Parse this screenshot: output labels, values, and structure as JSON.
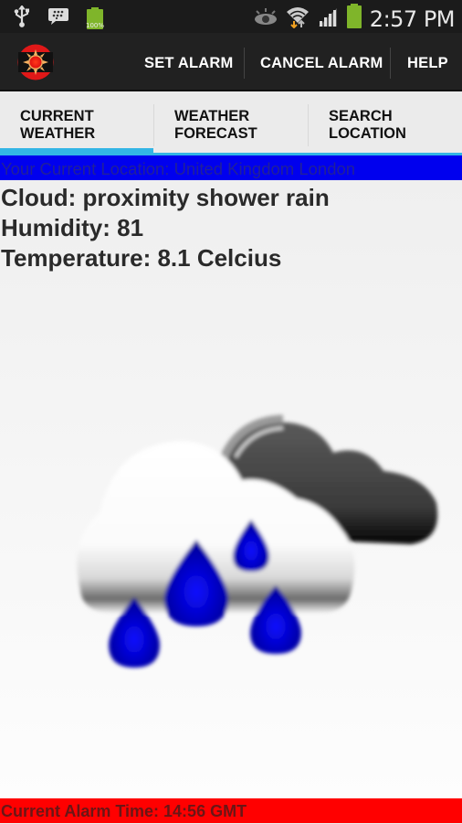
{
  "status_bar": {
    "time": "2:57 PM",
    "battery_small_label": "100%",
    "left_icons": [
      "usb-icon",
      "bbm-chat-icon",
      "battery-full-icon"
    ],
    "right_icons": [
      "eye-icon",
      "wifi-icon",
      "signal-icon",
      "battery-icon"
    ]
  },
  "action_bar": {
    "logo": "sun-alarm-logo",
    "actions": [
      {
        "label": "SET ALARM"
      },
      {
        "label": "CANCEL ALARM"
      },
      {
        "label": "HELP"
      }
    ]
  },
  "tabs": [
    {
      "label": "CURRENT\nWEATHER",
      "selected": true
    },
    {
      "label": "WEATHER\nFORECAST",
      "selected": false
    },
    {
      "label": "SEARCH\nLOCATION",
      "selected": false
    }
  ],
  "location_text": "Your Current Location: United Kingdom London",
  "weather": {
    "cloud": "Cloud: proximity shower rain",
    "humidity": "Humidity: 81",
    "temperature": "Temperature: 8.1 Celcius",
    "icon": "shower-rain-cloud-icon"
  },
  "alarm_text": "Current Alarm Time: 14:56 GMT",
  "colors": {
    "tab_indicator": "#33b5e5",
    "location_bar": "#0000ee",
    "alarm_bar": "#ff0000",
    "action_bar": "#212121",
    "raindrop": "#0000cc"
  }
}
